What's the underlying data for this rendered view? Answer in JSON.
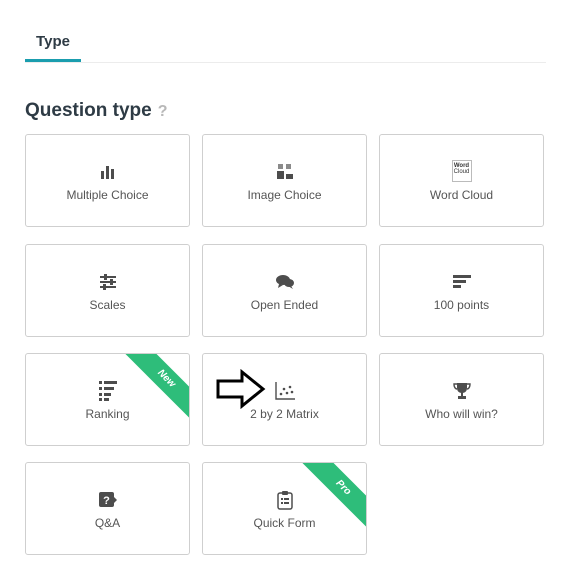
{
  "tabs": [
    {
      "label": "Type"
    }
  ],
  "section": {
    "title": "Question type",
    "help_icon": "?"
  },
  "cards": [
    {
      "label": "Multiple Choice",
      "icon": "bar-chart-icon"
    },
    {
      "label": "Image Choice",
      "icon": "image-choice-icon"
    },
    {
      "label": "Word Cloud",
      "icon": "word-cloud-icon",
      "icon_text": [
        "Word",
        "Cloud"
      ]
    },
    {
      "label": "Scales",
      "icon": "sliders-icon"
    },
    {
      "label": "Open Ended",
      "icon": "speech-bubbles-icon"
    },
    {
      "label": "100 points",
      "icon": "horizontal-bars-icon"
    },
    {
      "label": "Ranking",
      "icon": "ranking-icon",
      "ribbon": "New"
    },
    {
      "label": "2 by 2 Matrix",
      "icon": "scatter-plot-icon"
    },
    {
      "label": "Who will win?",
      "icon": "trophy-icon"
    },
    {
      "label": "Q&A",
      "icon": "question-bubble-icon"
    },
    {
      "label": "Quick Form",
      "icon": "clipboard-icon",
      "ribbon": "Pro"
    }
  ],
  "colors": {
    "accent": "#1a9dae",
    "ribbon": "#2ebd7a",
    "icon": "#4d4d4d"
  }
}
